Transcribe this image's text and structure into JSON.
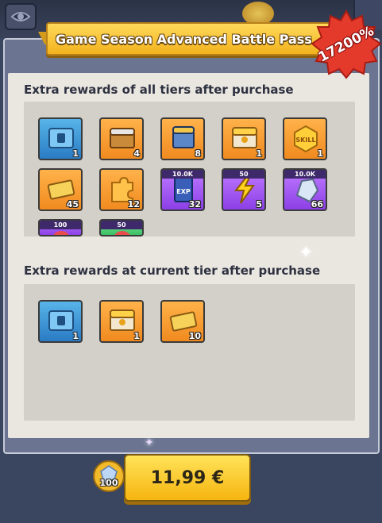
{
  "banner": {
    "title": "Game Season Advanced Battle Pass"
  },
  "badge": {
    "percent": "17200%"
  },
  "sections": {
    "all_tiers": {
      "title": "Extra rewards of all tiers after purchase",
      "items": [
        {
          "icon": "blue-crate-icon",
          "color": "blue",
          "qty": "1",
          "cap": ""
        },
        {
          "icon": "wooden-chest-icon",
          "color": "orange",
          "qty": "4",
          "cap": ""
        },
        {
          "icon": "blue-chest-icon",
          "color": "orange",
          "qty": "8",
          "cap": ""
        },
        {
          "icon": "gold-chest-icon",
          "color": "orange",
          "qty": "1",
          "cap": ""
        },
        {
          "icon": "gold-skill-coin-icon",
          "color": "orange",
          "qty": "1",
          "cap": ""
        },
        {
          "icon": "gold-ticket-icon",
          "color": "orange",
          "qty": "45",
          "cap": ""
        },
        {
          "icon": "puzzle-piece-icon",
          "color": "orange",
          "qty": "12",
          "cap": ""
        },
        {
          "icon": "exp-book-icon",
          "color": "purple",
          "qty": "32",
          "cap": "10.0K"
        },
        {
          "icon": "lightning-icon",
          "color": "purple",
          "qty": "5",
          "cap": "50"
        },
        {
          "icon": "diamond-ore-icon",
          "color": "purple",
          "qty": "66",
          "cap": "10.0K"
        },
        {
          "icon": "partial-item-icon",
          "color": "purple",
          "qty": "",
          "cap": "100"
        },
        {
          "icon": "partial-item-icon",
          "color": "green",
          "qty": "",
          "cap": "50"
        }
      ]
    },
    "current_tier": {
      "title": "Extra rewards at current tier after purchase",
      "items": [
        {
          "icon": "blue-crate-icon",
          "color": "blue",
          "qty": "1"
        },
        {
          "icon": "gold-chest-icon",
          "color": "orange",
          "qty": "1"
        },
        {
          "icon": "gold-ticket-icon",
          "color": "orange",
          "qty": "10"
        }
      ]
    }
  },
  "purchase": {
    "price": "11,99 €",
    "bonus_qty": "100"
  },
  "colors": {
    "accent": "#f6b50f",
    "badge": "#e43a2b",
    "panel": "#eae6e0"
  }
}
